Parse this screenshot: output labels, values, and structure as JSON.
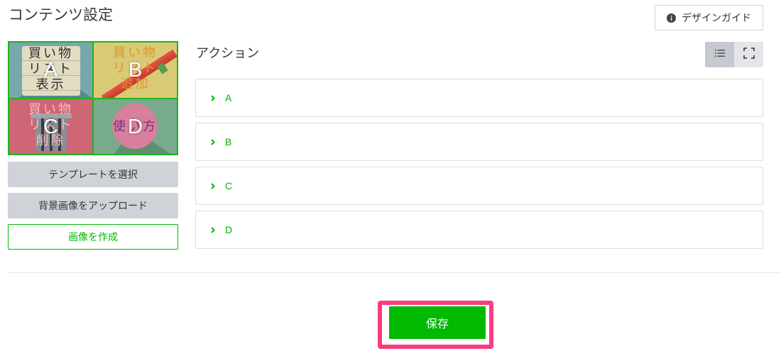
{
  "header": {
    "title": "コンテンツ設定",
    "design_guide_label": "デザインガイド",
    "design_guide_icon": "info-icon"
  },
  "image_grid": {
    "cells": [
      {
        "letter": "A",
        "lines": [
          "買い物",
          "リスト",
          "表示"
        ]
      },
      {
        "letter": "B",
        "lines": [
          "買い物",
          "リスト",
          "追加"
        ]
      },
      {
        "letter": "C",
        "lines": [
          "買い物",
          "リスト",
          "削除"
        ]
      },
      {
        "letter": "D",
        "lines": [
          "使い方"
        ]
      }
    ]
  },
  "sidebar_buttons": {
    "select_template": "テンプレートを選択",
    "upload_background": "背景画像をアップロード",
    "create_image": "画像を作成"
  },
  "actions": {
    "title": "アクション",
    "view_toggle": {
      "list_icon": "list-icon",
      "fullscreen_icon": "fullscreen-icon",
      "list_active": true
    },
    "chevron_icon": "chevron-right-icon",
    "items": [
      {
        "label": "A"
      },
      {
        "label": "B"
      },
      {
        "label": "C"
      },
      {
        "label": "D"
      }
    ]
  },
  "footer": {
    "save_label": "保存"
  },
  "colors": {
    "accent": "#00b900",
    "highlight": "#fb3b82",
    "secondary_button": "#cfd3d9",
    "toggle_active": "#c5c9d0",
    "toggle_idle": "#e3e5e9"
  }
}
